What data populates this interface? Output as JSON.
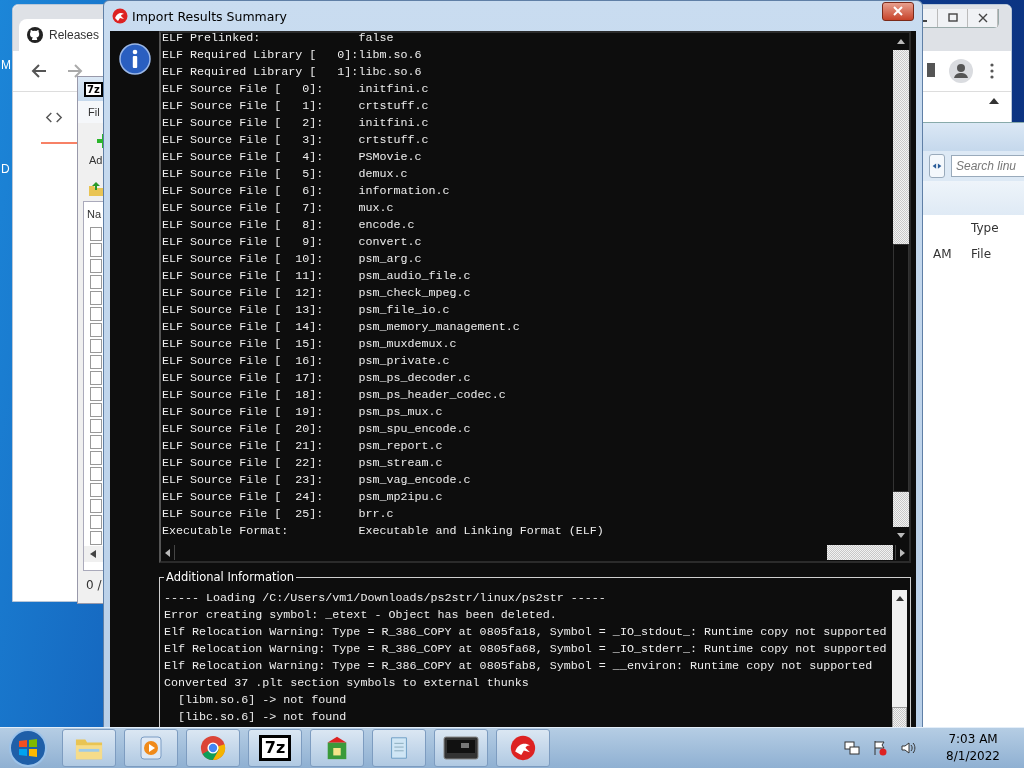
{
  "desktop": {
    "icon_labels": [
      "M",
      "D"
    ]
  },
  "browser": {
    "tab_title": "Releases"
  },
  "archiver": {
    "logo": "7z",
    "menu": "Fil",
    "toolbar_label": "Ad",
    "column": "Na",
    "status": "0 /"
  },
  "explorer": {
    "search": {
      "placeholder": "Search linu"
    },
    "columns": [
      "Type"
    ],
    "row": [
      "AM",
      "File"
    ]
  },
  "dialog": {
    "title": "Import Results Summary",
    "summary": [
      {
        "label": "ELF Prelinked:",
        "value": "false"
      },
      {
        "label": "ELF Required Library [   0]:",
        "value": "libm.so.6"
      },
      {
        "label": "ELF Required Library [   1]:",
        "value": "libc.so.6"
      },
      {
        "label": "ELF Source File [   0]:",
        "value": "initfini.c"
      },
      {
        "label": "ELF Source File [   1]:",
        "value": "crtstuff.c"
      },
      {
        "label": "ELF Source File [   2]:",
        "value": "initfini.c"
      },
      {
        "label": "ELF Source File [   3]:",
        "value": "crtstuff.c"
      },
      {
        "label": "ELF Source File [   4]:",
        "value": "PSMovie.c"
      },
      {
        "label": "ELF Source File [   5]:",
        "value": "demux.c"
      },
      {
        "label": "ELF Source File [   6]:",
        "value": "information.c"
      },
      {
        "label": "ELF Source File [   7]:",
        "value": "mux.c"
      },
      {
        "label": "ELF Source File [   8]:",
        "value": "encode.c"
      },
      {
        "label": "ELF Source File [   9]:",
        "value": "convert.c"
      },
      {
        "label": "ELF Source File [  10]:",
        "value": "psm_arg.c"
      },
      {
        "label": "ELF Source File [  11]:",
        "value": "psm_audio_file.c"
      },
      {
        "label": "ELF Source File [  12]:",
        "value": "psm_check_mpeg.c"
      },
      {
        "label": "ELF Source File [  13]:",
        "value": "psm_file_io.c"
      },
      {
        "label": "ELF Source File [  14]:",
        "value": "psm_memory_management.c"
      },
      {
        "label": "ELF Source File [  15]:",
        "value": "psm_muxdemux.c"
      },
      {
        "label": "ELF Source File [  16]:",
        "value": "psm_private.c"
      },
      {
        "label": "ELF Source File [  17]:",
        "value": "psm_ps_decoder.c"
      },
      {
        "label": "ELF Source File [  18]:",
        "value": "psm_ps_header_codec.c"
      },
      {
        "label": "ELF Source File [  19]:",
        "value": "psm_ps_mux.c"
      },
      {
        "label": "ELF Source File [  20]:",
        "value": "psm_spu_encode.c"
      },
      {
        "label": "ELF Source File [  21]:",
        "value": "psm_report.c"
      },
      {
        "label": "ELF Source File [  22]:",
        "value": "psm_stream.c"
      },
      {
        "label": "ELF Source File [  23]:",
        "value": "psm_vag_encode.c"
      },
      {
        "label": "ELF Source File [  24]:",
        "value": "psm_mp2ipu.c"
      },
      {
        "label": "ELF Source File [  25]:",
        "value": "brr.c"
      },
      {
        "label": "Executable Format:",
        "value": "Executable and Linking Format (ELF)"
      }
    ],
    "additional": {
      "title": "Additional Information",
      "lines": [
        "----- Loading /C:/Users/vm1/Downloads/ps2str/linux/ps2str -----",
        "Error creating symbol: _etext - Object has been deleted.",
        "Elf Relocation Warning: Type = R_386_COPY at 0805fa18, Symbol = _IO_stdout_: Runtime copy not supported",
        "Elf Relocation Warning: Type = R_386_COPY at 0805fa68, Symbol = _IO_stderr_: Runtime copy not supported",
        "Elf Relocation Warning: Type = R_386_COPY at 0805fab8, Symbol = __environ: Runtime copy not supported",
        "Converted 37 .plt section symbols to external thunks",
        "  [libm.so.6] -> not found",
        "  [libc.so.6] -> not found"
      ]
    }
  },
  "taskbar": {
    "apps": [
      {
        "kind": "folder"
      },
      {
        "kind": "media"
      },
      {
        "kind": "browser"
      },
      {
        "kind": "archive",
        "label": "7z"
      },
      {
        "kind": "installer"
      },
      {
        "kind": "notepad"
      },
      {
        "kind": "terminal"
      },
      {
        "kind": "dragon"
      }
    ],
    "time": "7:03 AM",
    "date": "8/1/2022"
  }
}
